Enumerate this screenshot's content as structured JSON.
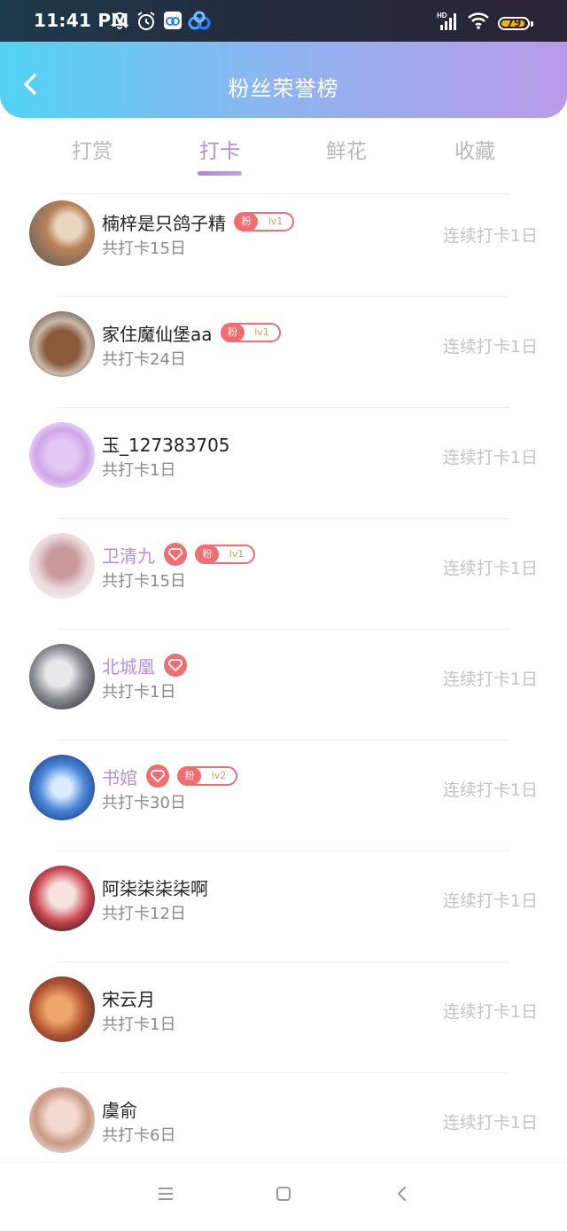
{
  "status": {
    "time": "11:41 PM",
    "battery": "79"
  },
  "header": {
    "title": "粉丝荣誉榜"
  },
  "tabs": [
    {
      "label": "打赏",
      "active": false
    },
    {
      "label": "打卡",
      "active": true
    },
    {
      "label": "鲜花",
      "active": false
    },
    {
      "label": "收藏",
      "active": false
    }
  ],
  "rows": [
    {
      "name": "楠梓是只鸽子精",
      "total": "共打卡15日",
      "streak": "连续打卡1日",
      "fan": {
        "tag": "粉",
        "level": "lv1"
      }
    },
    {
      "name": "家住魔仙堡aa",
      "total": "共打卡24日",
      "streak": "连续打卡1日",
      "fan": {
        "tag": "粉",
        "level": "lv1"
      }
    },
    {
      "name": "玉_127383705",
      "total": "共打卡1日",
      "streak": "连续打卡1日"
    },
    {
      "name": "卫清九",
      "total": "共打卡15日",
      "streak": "连续打卡1日",
      "vip": true,
      "fan": {
        "tag": "粉",
        "level": "lv1"
      }
    },
    {
      "name": "北城凰",
      "total": "共打卡1日",
      "streak": "连续打卡1日",
      "vip": true
    },
    {
      "name": "书婠",
      "total": "共打卡30日",
      "streak": "连续打卡1日",
      "vip": true,
      "fan": {
        "tag": "粉",
        "level": "lv2"
      }
    },
    {
      "name": "阿柒柒柒柒啊",
      "total": "共打卡12日",
      "streak": "连续打卡1日"
    },
    {
      "name": "宋云月",
      "total": "共打卡1日",
      "streak": "连续打卡1日"
    },
    {
      "name": "虞俞",
      "total": "共打卡6日",
      "streak": "连续打卡1日"
    }
  ],
  "colors": {
    "accent": "#b38ee0",
    "badge": "#f06e72",
    "headerStart": "#52d3f6",
    "headerEnd": "#b99ae9"
  }
}
